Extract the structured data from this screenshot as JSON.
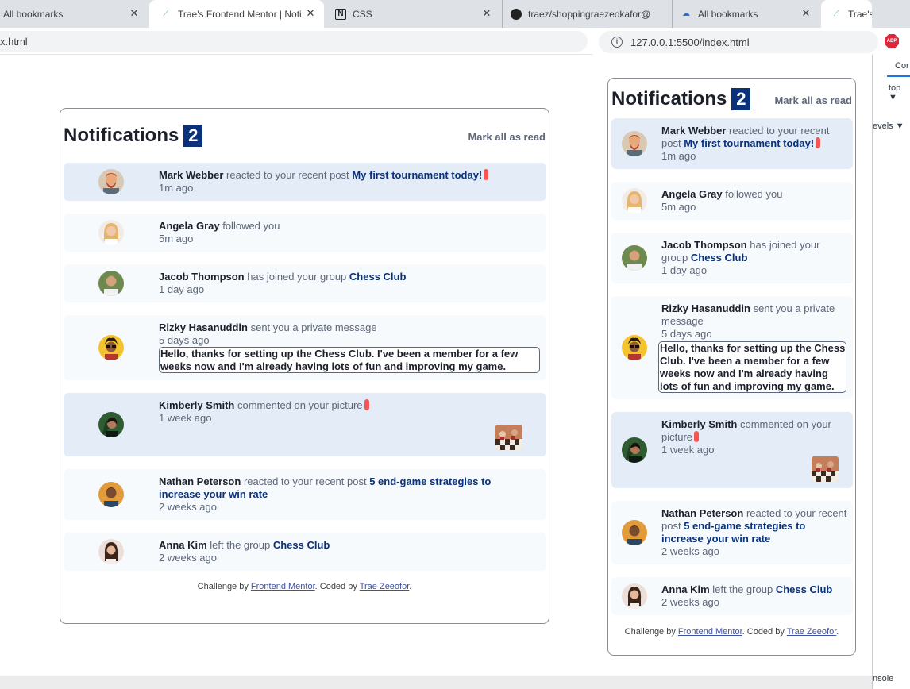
{
  "browser": {
    "tabs": [
      {
        "title": "All bookmarks",
        "icon": "bookmark-icon",
        "active": false
      },
      {
        "title": "Trae's Frontend Mentor | Noti",
        "icon": "frontend-mentor-icon",
        "active": true
      },
      {
        "title": "CSS",
        "icon": "notion-icon",
        "active": false
      },
      {
        "title": "traez/shoppingraezeokafor@",
        "icon": "github-icon",
        "active": false
      },
      {
        "title": "All bookmarks",
        "icon": "cloud-icon",
        "active": false
      },
      {
        "title": "Trae's",
        "icon": "frontend-mentor-icon",
        "active": false
      }
    ],
    "left_url": "x.html",
    "right_url": "127.0.0.1:5500/index.html",
    "extension_label": "ABP",
    "devtools": {
      "tab": "Cor",
      "context": "top ▼",
      "levels": "evels ▼",
      "console": "nsole"
    }
  },
  "notifications": {
    "title": "Notifications",
    "count": "2",
    "mark_all_label": "Mark all as read",
    "items": [
      {
        "name": "Mark Webber",
        "action": "reacted to your recent post",
        "target": "My first tournament today!",
        "time": "1m ago",
        "unread": true
      },
      {
        "name": "Angela Gray",
        "action": "followed you",
        "time": "5m ago",
        "unread": false
      },
      {
        "name": "Jacob Thompson",
        "action": "has joined your group",
        "group": "Chess Club",
        "time": "1 day ago",
        "unread": false
      },
      {
        "name": "Rizky Hasanuddin",
        "action": "sent you a private message",
        "time": "5 days ago",
        "message": "Hello, thanks for setting up the Chess Club. I've been a member for a few weeks now and I'm already having lots of fun and improving my game.",
        "unread": false
      },
      {
        "name": "Kimberly Smith",
        "action": "commented on your picture",
        "time": "1 week ago",
        "unread": true
      },
      {
        "name": "Nathan Peterson",
        "action": "reacted to your recent post",
        "target": "5 end-game strategies to increase your win rate",
        "time": "2 weeks ago",
        "unread": false
      },
      {
        "name": "Anna Kim",
        "action": "left the group",
        "group": "Chess Club",
        "time": "2 weeks ago",
        "unread": false
      }
    ],
    "footer": {
      "challenge_prefix": "Challenge by",
      "challenge_link": "Frontend Mentor",
      "coded_prefix": ". Coded by",
      "coded_link": "Trae Zeeofor",
      "suffix": "."
    }
  },
  "colors": {
    "accent": "#0a327b",
    "unread_bg": "#e3ecf7",
    "read_bg": "#f7fafd",
    "dot": "#f65552",
    "tab_bar": "#dee1e6"
  }
}
